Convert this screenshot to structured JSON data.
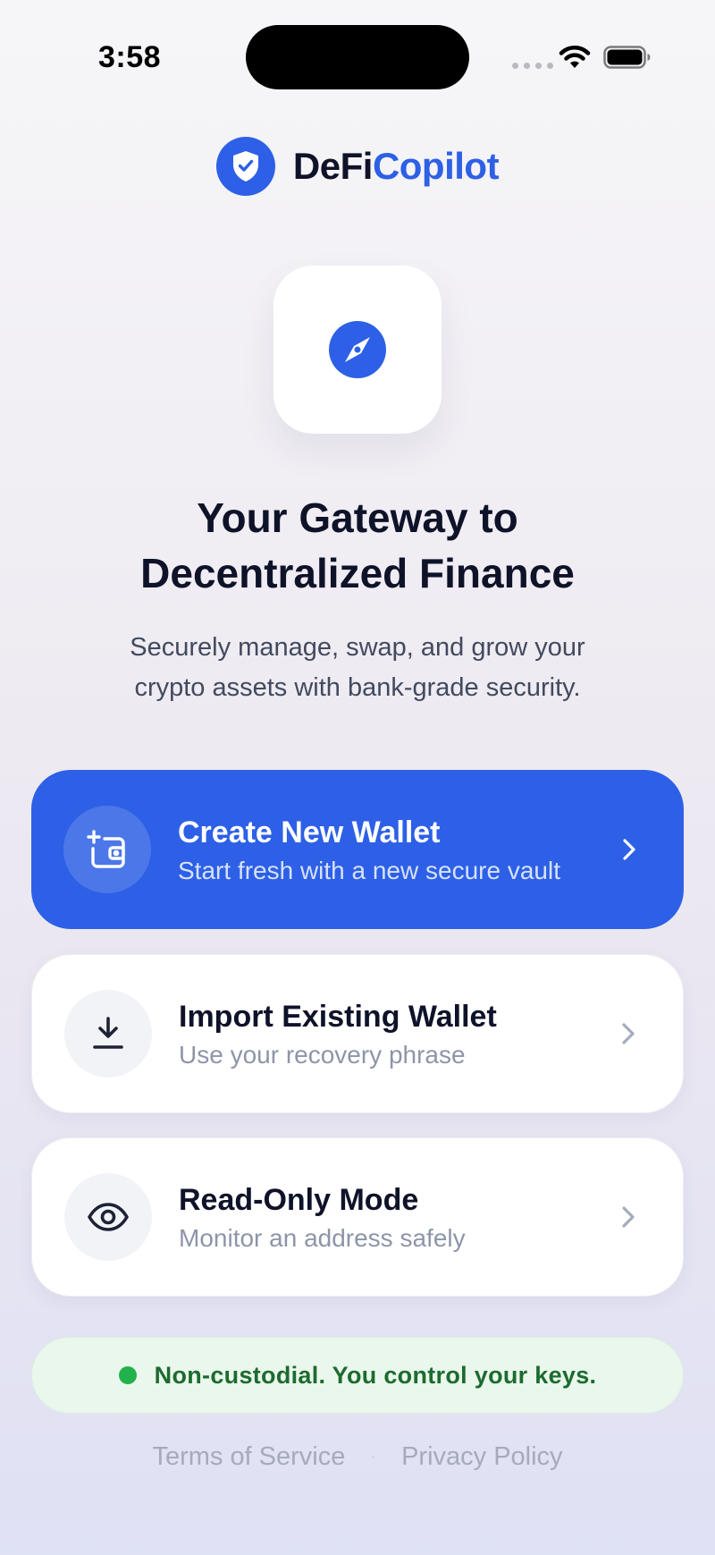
{
  "status_bar": {
    "time": "3:58",
    "wifi_icon": "wifi-icon",
    "battery_icon": "battery-icon"
  },
  "brand": {
    "name_part1": "DeFi",
    "name_part2": "Copilot",
    "logo_icon": "shield-check-icon",
    "accent_color": "#2d60e6"
  },
  "hero": {
    "icon": "compass-icon",
    "headline_line1": "Your Gateway to",
    "headline_line2": "Decentralized Finance",
    "subtitle_line1": "Securely manage, swap, and grow your",
    "subtitle_line2": "crypto assets with bank-grade security."
  },
  "actions": [
    {
      "title": "Create New Wallet",
      "subtitle": "Start fresh with a new secure vault",
      "icon": "wallet-add-icon"
    },
    {
      "title": "Import Existing Wallet",
      "subtitle": "Use your recovery phrase",
      "icon": "download-icon"
    },
    {
      "title": "Read-Only Mode",
      "subtitle": "Monitor an address safely",
      "icon": "eye-icon"
    }
  ],
  "security_note": {
    "text": "Non-custodial. You control your keys.",
    "status_color": "#22b24c"
  },
  "footer": {
    "terms": "Terms of Service",
    "separator": "·",
    "privacy": "Privacy Policy"
  }
}
